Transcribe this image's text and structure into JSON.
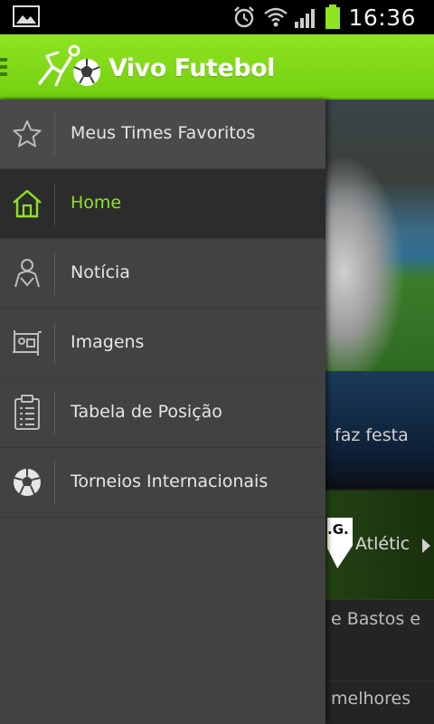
{
  "status_bar": {
    "time": "16:36",
    "icons": [
      "gallery-icon",
      "alarm-icon",
      "wifi-icon",
      "signal-icon",
      "battery-icon"
    ],
    "battery_color": "#8ee421"
  },
  "app_bar": {
    "title": "Vivo Futebol",
    "background_color": "#7ed619",
    "logo_icon": "soccer-player-logo-icon"
  },
  "drawer": {
    "accent_color": "#8ee421",
    "items": [
      {
        "label": "Meus Times Favoritos",
        "icon": "star-icon"
      },
      {
        "label": "Home",
        "icon": "home-icon",
        "active": true
      },
      {
        "label": "Notícia",
        "icon": "news-person-icon"
      },
      {
        "label": "Imagens",
        "icon": "image-icon"
      },
      {
        "label": "Tabela de Posição",
        "icon": "clipboard-table-icon"
      },
      {
        "label": "Torneios Internacionais",
        "icon": "soccer-ball-icon"
      }
    ]
  },
  "content": {
    "hero_caption": "faz festa",
    "match_card": {
      "crest_text": ".G.",
      "team": "Atlétic"
    },
    "news": [
      {
        "text": "e Bastos e"
      },
      {
        "text": "melhores"
      }
    ]
  }
}
